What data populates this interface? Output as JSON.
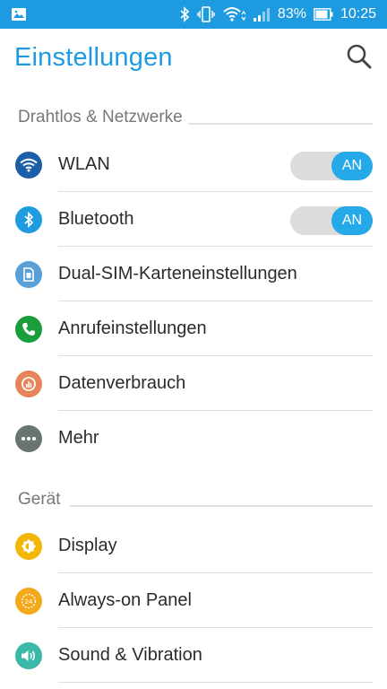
{
  "status_bar": {
    "battery_percent": "83%",
    "time": "10:25",
    "icons": [
      "image-notification-icon",
      "bluetooth-icon",
      "vibrate-icon",
      "wifi-icon",
      "signal-icon",
      "battery-icon"
    ]
  },
  "app_bar": {
    "title": "Einstellungen",
    "search_icon": "search-icon"
  },
  "sections": {
    "wireless": {
      "title": "Drahtlos & Netzwerke"
    },
    "device": {
      "title": "Gerät"
    }
  },
  "rows": {
    "wlan": {
      "label": "WLAN",
      "toggle": "AN",
      "icon": "wifi-icon",
      "color": "#1d5ea8"
    },
    "bluetooth": {
      "label": "Bluetooth",
      "toggle": "AN",
      "icon": "bluetooth-icon",
      "color": "#1e9be0"
    },
    "dual_sim": {
      "label": "Dual-SIM-Karteneinstellungen",
      "icon": "sim-card-icon",
      "color": "#5aa0d8"
    },
    "calls": {
      "label": "Anrufeinstellungen",
      "icon": "phone-icon",
      "color": "#1a9e3c"
    },
    "data_usage": {
      "label": "Datenverbrauch",
      "icon": "data-usage-icon",
      "color": "#e8825a"
    },
    "more": {
      "label": "Mehr",
      "icon": "more-icon",
      "color": "#6b7570"
    },
    "display": {
      "label": "Display",
      "icon": "brightness-icon",
      "color": "#f2b705"
    },
    "always_on": {
      "label": "Always-on Panel",
      "icon": "always-on-icon",
      "color": "#f2a91a"
    },
    "sound": {
      "label": "Sound & Vibration",
      "icon": "speaker-icon",
      "color": "#3bb8a8"
    }
  },
  "colors": {
    "accent": "#1e9be0",
    "toggle_on": "#26a9e8",
    "toggle_track": "#dcdcdc"
  }
}
